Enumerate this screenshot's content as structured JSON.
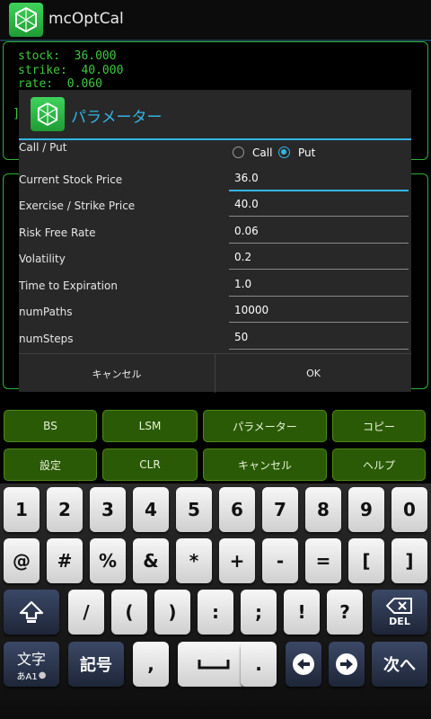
{
  "app": {
    "title": "mcOptCal"
  },
  "console": {
    "text": "stock:  36.000\nstrike:  40.000\nrate:  0.060"
  },
  "actions": {
    "row1": [
      "BS",
      "LSM",
      "パラメーター",
      "コピー"
    ],
    "row2": [
      "設定",
      "CLR",
      "キャンセル",
      "ヘルプ"
    ]
  },
  "dialog": {
    "title": "パラメーター",
    "call_put_label": "Call / Put",
    "call_label": "Call",
    "put_label": "Put",
    "selected_option": "Put",
    "fields": [
      {
        "label": "Current Stock Price",
        "value": "36.0"
      },
      {
        "label": "Exercise / Strike Price",
        "value": "40.0"
      },
      {
        "label": "Risk Free Rate",
        "value": "0.06"
      },
      {
        "label": "Volatility",
        "value": "0.2"
      },
      {
        "label": "Time to Expiration",
        "value": "1.0"
      },
      {
        "label": "numPaths",
        "value": "10000"
      },
      {
        "label": "numSteps",
        "value": "50"
      }
    ],
    "cancel_label": "キャンセル",
    "ok_label": "OK"
  },
  "keyboard": {
    "row1": [
      "1",
      "2",
      "3",
      "4",
      "5",
      "6",
      "7",
      "8",
      "9",
      "0"
    ],
    "row2": [
      "@",
      "#",
      "%",
      "&",
      "*",
      "+",
      "-",
      "=",
      "[",
      "]"
    ],
    "row3": [
      "/",
      "(",
      ")",
      ":",
      ";",
      "!",
      "?"
    ],
    "del_label": "DEL",
    "mode_label": "文字",
    "mode_sub": "あA1",
    "symbol_label": "記号",
    "comma": ",",
    "period": ".",
    "next_label": "次へ"
  },
  "colors": {
    "accent": "#33b5e5",
    "console_text": "#3ec83e",
    "button_green": "#2a5a06"
  }
}
